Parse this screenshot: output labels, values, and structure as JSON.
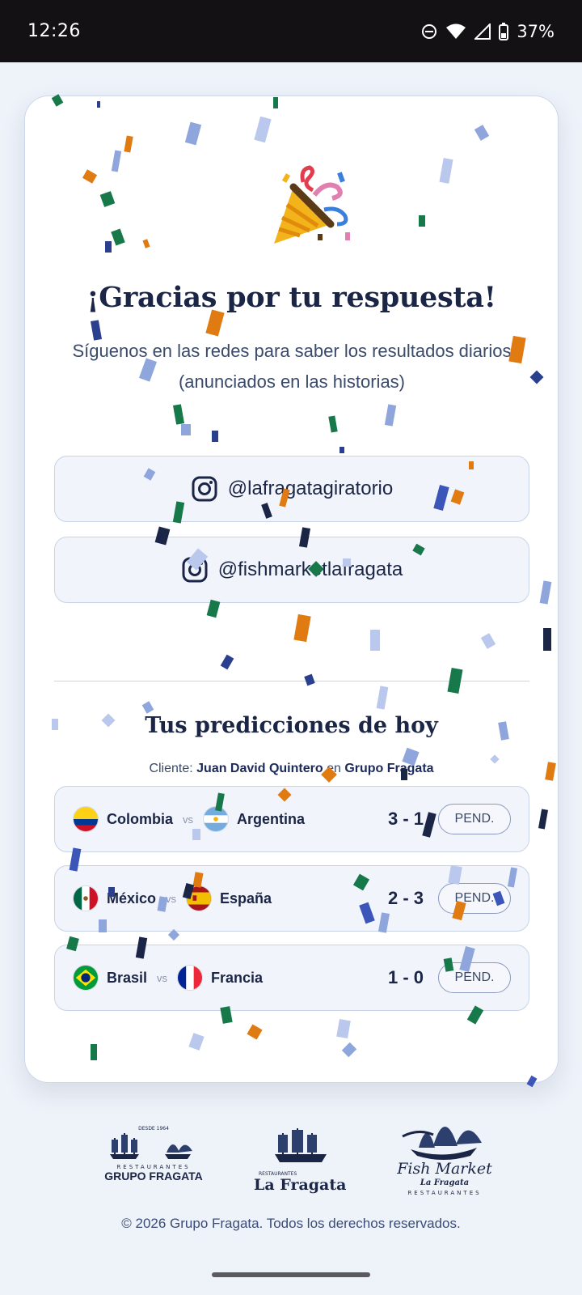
{
  "status": {
    "time": "12:26",
    "battery": "37%"
  },
  "thanks": {
    "icon": "party-popper-icon",
    "title": "¡Gracias por tu respuesta!",
    "subtitle": "Síguenos en las redes para saber los resultados diarios (anunciados en las historias)"
  },
  "socials": [
    {
      "handle": "@lafragatagiratorio",
      "icon": "instagram-icon"
    },
    {
      "handle": "@fishmarketlafragata",
      "icon": "instagram-icon"
    }
  ],
  "predictions": {
    "title": "Tus predicciones de hoy",
    "client_prefix": "Cliente:",
    "client_name": "Juan David Quintero",
    "client_mid": "en",
    "client_company": "Grupo Fragata",
    "vs_label": "vs",
    "matches": [
      {
        "home": "Colombia",
        "away": "Argentina",
        "score": "3 - 1",
        "status": "PEND."
      },
      {
        "home": "México",
        "away": "España",
        "score": "2 - 3",
        "status": "PEND."
      },
      {
        "home": "Brasil",
        "away": "Francia",
        "score": "1 - 0",
        "status": "PEND."
      }
    ]
  },
  "brands": {
    "grupo_top": "DESDE 1964",
    "grupo_sub": "RESTAURANTES",
    "grupo_name": "GRUPO FRAGATA",
    "lafragata_sub": "RESTAURANTES",
    "lafragata_name": "La Fragata",
    "fish_name": "Fish Market",
    "fish_sub": "La Fragata",
    "fish_rest": "RESTAURANTES"
  },
  "footer": "© 2026 Grupo Fragata. Todos los derechos reservados.",
  "colors": {
    "navy": "#1b2647",
    "orange": "#e07b12",
    "green": "#17784a",
    "lightblue": "#8ea6dc"
  }
}
